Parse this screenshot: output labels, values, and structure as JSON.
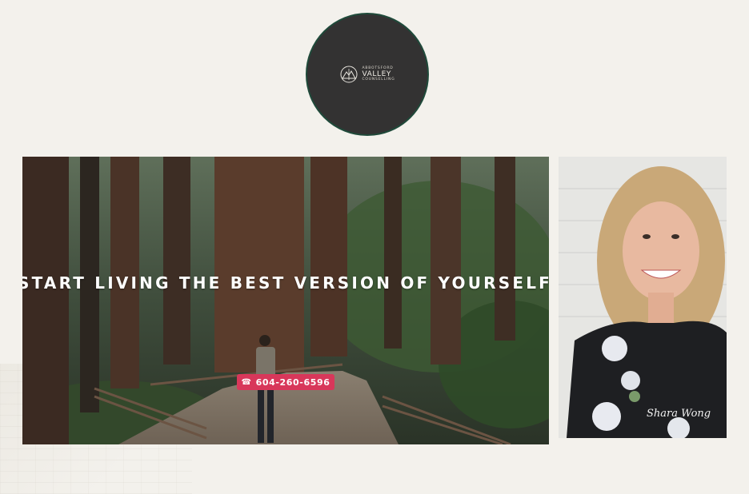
{
  "logo": {
    "line1": "ABBOTSFORD",
    "line2": "VALLEY",
    "line3": "COUNSELLING"
  },
  "hero": {
    "headline": "START LIVING THE BEST VERSION OF YOURSELF",
    "phone_label": "604-260-6596",
    "phone_icon": "phone-icon"
  },
  "portrait": {
    "signature": "Shara Wong"
  },
  "colors": {
    "background": "#f3f1ec",
    "logo_circle": "#333232",
    "logo_ring": "#1f4a3a",
    "cta": "#d8375a"
  }
}
